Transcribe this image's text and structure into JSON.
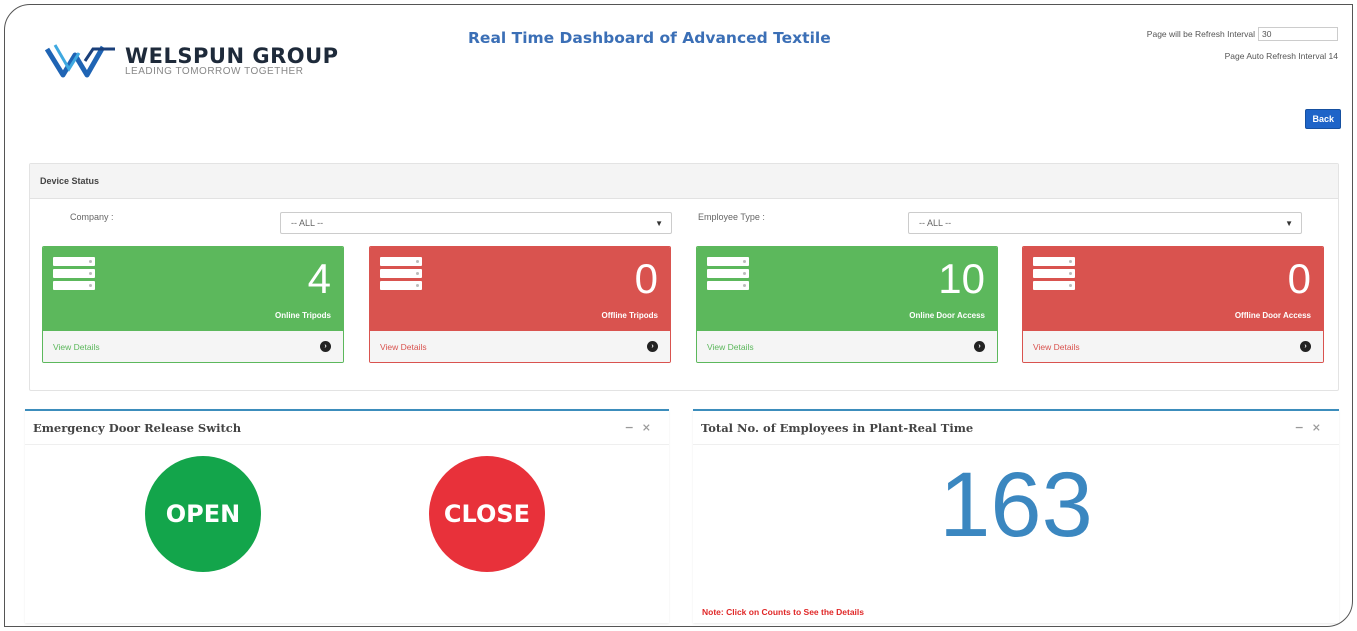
{
  "header": {
    "brand_name": "WELSPUN GROUP",
    "brand_tagline": "LEADING TOMORROW TOGETHER",
    "title": "Real Time Dashboard of Advanced Textile",
    "refresh_label": "Page will be Refresh Interval",
    "refresh_value": "30",
    "auto_refresh_label": "Page Auto Refresh Interval 14",
    "back_label": "Back"
  },
  "device_status": {
    "title": "Device Status",
    "company_label": "Company :",
    "company_value": "-- ALL --",
    "employee_type_label": "Employee Type :",
    "employee_type_value": "-- ALL --",
    "cards": [
      {
        "count": "4",
        "label": "Online Tripods",
        "link": "View Details",
        "status": "online",
        "color": "#5cb85c"
      },
      {
        "count": "0",
        "label": "Offline Tripods",
        "link": "View Details",
        "status": "offline",
        "color": "#d9534f"
      },
      {
        "count": "10",
        "label": "Online Door Access",
        "link": "View Details",
        "status": "online",
        "color": "#5cb85c"
      },
      {
        "count": "0",
        "label": "Offline Door Access",
        "link": "View Details",
        "status": "offline",
        "color": "#d9534f"
      }
    ]
  },
  "emergency": {
    "title": "Emergency Door Release Switch",
    "open_label": "OPEN",
    "close_label": "CLOSE",
    "minimize_icon": "minus-icon",
    "close_icon": "times-icon"
  },
  "employees": {
    "title": "Total No. of Employees in Plant-Real Time",
    "count": "163",
    "note": "Note: Click on Counts to See the Details",
    "accent_color": "#3b87c0"
  }
}
